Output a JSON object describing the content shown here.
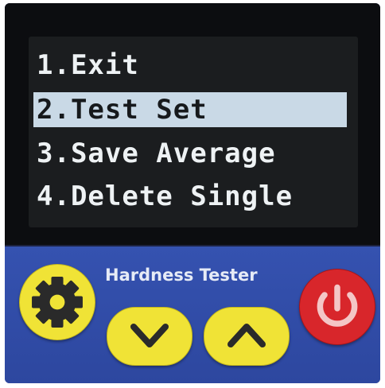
{
  "screen": {
    "menu_items": [
      {
        "label": "1.Exit",
        "selected": false
      },
      {
        "label": "2.Test Set",
        "selected": true
      },
      {
        "label": "3.Save Average",
        "selected": false
      },
      {
        "label": "4.Delete Single",
        "selected": false
      }
    ]
  },
  "panel": {
    "brand_label": "Hardness Tester",
    "buttons": {
      "settings_icon": "gear-icon",
      "down_icon": "chevron-down-icon",
      "up_icon": "chevron-up-icon",
      "power_icon": "power-icon"
    }
  },
  "colors": {
    "panel_blue": "#2f49a4",
    "button_yellow": "#f0e336",
    "power_red": "#d8262b",
    "screen_background": "#1b1d1f",
    "selection_highlight": "#c9d9e6"
  }
}
